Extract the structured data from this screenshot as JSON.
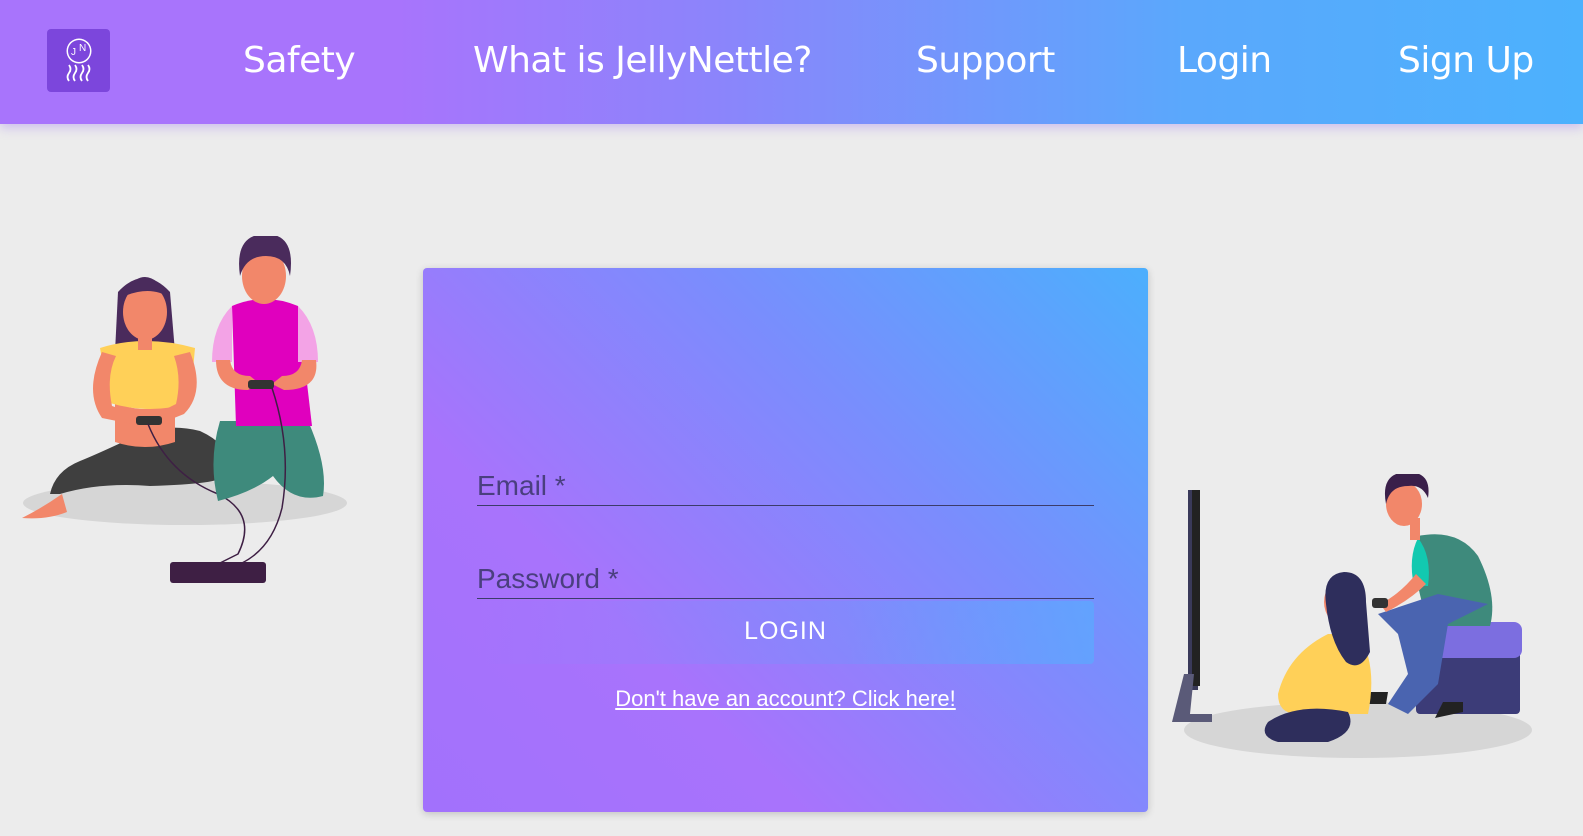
{
  "nav": {
    "logo_letters": "JN",
    "links": [
      "Safety",
      "What is JellyNettle?",
      "Support",
      "Login",
      "Sign Up"
    ]
  },
  "login_form": {
    "email_placeholder": "Email *",
    "password_placeholder": "Password *",
    "submit_label": "LOGIN",
    "signup_link": "Don't have an account? Click here!"
  },
  "illustrations": {
    "left": "two-people-gaming-icon",
    "right": "couple-gaming-at-tv-icon"
  },
  "colors": {
    "gradient_purple": "#a874fc",
    "gradient_blue": "#4cb1fd",
    "background": "#ececec",
    "logo_bg": "#7c46dc"
  }
}
